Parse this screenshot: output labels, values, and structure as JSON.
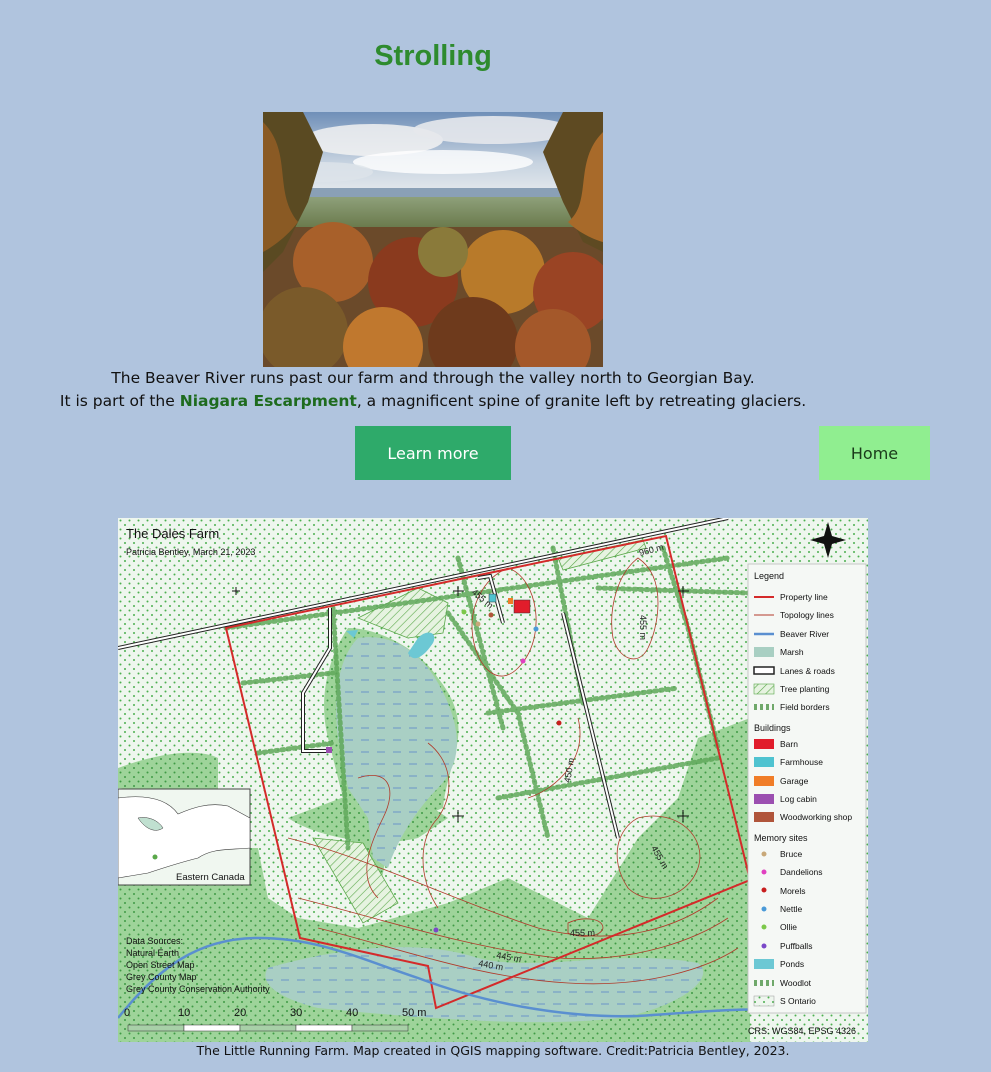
{
  "page": {
    "title": "Strolling",
    "intro_line1": "The Beaver River runs past our farm and through the valley north to Georgian Bay.",
    "intro_line2_pre": "It is part of the ",
    "intro_link": "Niagara Escarpment",
    "intro_line2_post": ", a magnificent spine of granite left by retreating glaciers.",
    "learn_more": "Learn more",
    "home": "Home",
    "caption": "The Little Running Farm. Map created in QGIS mapping software. Credit:Patricia Bentley, 2023."
  },
  "map": {
    "title": "The Dales Farm",
    "subtitle": "Patricia Bentley, March 21, 2023",
    "legend_title": "Legend",
    "legend_items": [
      {
        "label": "Property line",
        "icon": "red-line",
        "color": "#d42a2a"
      },
      {
        "label": "Topology lines",
        "icon": "thin-red-line",
        "color": "#b33a2a"
      },
      {
        "label": "Beaver River",
        "icon": "blue-line",
        "color": "#5a8fd0"
      },
      {
        "label": "Marsh",
        "icon": "marsh-swatch",
        "color": "#a8cfc2"
      },
      {
        "label": "Lanes & roads",
        "icon": "road-swatch",
        "color": "#222222"
      },
      {
        "label": "Tree planting",
        "icon": "hatch-swatch",
        "color": "#6ab04c"
      },
      {
        "label": "Field borders",
        "icon": "hedge-swatch",
        "color": "#6fa86a"
      }
    ],
    "buildings_title": "Buildings",
    "buildings": [
      {
        "label": "Barn",
        "color": "#e11d2b"
      },
      {
        "label": "Farmhouse",
        "color": "#4fc3d0"
      },
      {
        "label": "Garage",
        "color": "#f07d28"
      },
      {
        "label": "Log cabin",
        "color": "#9b4fb0"
      },
      {
        "label": "Woodworking shop",
        "color": "#b0553a"
      }
    ],
    "memory_title": "Memory sites",
    "memory": [
      {
        "label": "Bruce",
        "color": "#c8a878"
      },
      {
        "label": "Dandelions",
        "color": "#e040c0"
      },
      {
        "label": "Morels",
        "color": "#c81e1e"
      },
      {
        "label": "Nettle",
        "color": "#4a9ad8"
      },
      {
        "label": "Ollie",
        "color": "#7cc84a"
      },
      {
        "label": "Puffballs",
        "color": "#7a48c8"
      }
    ],
    "extra_legend": [
      {
        "label": "Ponds",
        "color": "#6cc8d4"
      },
      {
        "label": "Woodlot",
        "color": "#6fa86a"
      },
      {
        "label": "S Ontario",
        "color": "#e6f2e6"
      }
    ],
    "contours": [
      "960 m",
      "455 m",
      "455 m",
      "450 m",
      "455 m",
      "455 m",
      "445 m",
      "440 m"
    ],
    "inset_title": "Eastern Canada",
    "sources": [
      "Data Sources:",
      "Natural Earth",
      "Open Street Map",
      "Grey County Map",
      "Grey County Conservation Authority"
    ],
    "scale_labels": [
      "0",
      "10",
      "20",
      "30",
      "40",
      "50 m"
    ],
    "crs": "CRS: WGS84, EPSG 4326"
  },
  "colors": {
    "background": "#b0c4de",
    "title_green": "#2e8b2e",
    "link_green": "#1e6b1e",
    "learn_bg": "#2eaa6a",
    "home_bg": "#90ee90"
  }
}
